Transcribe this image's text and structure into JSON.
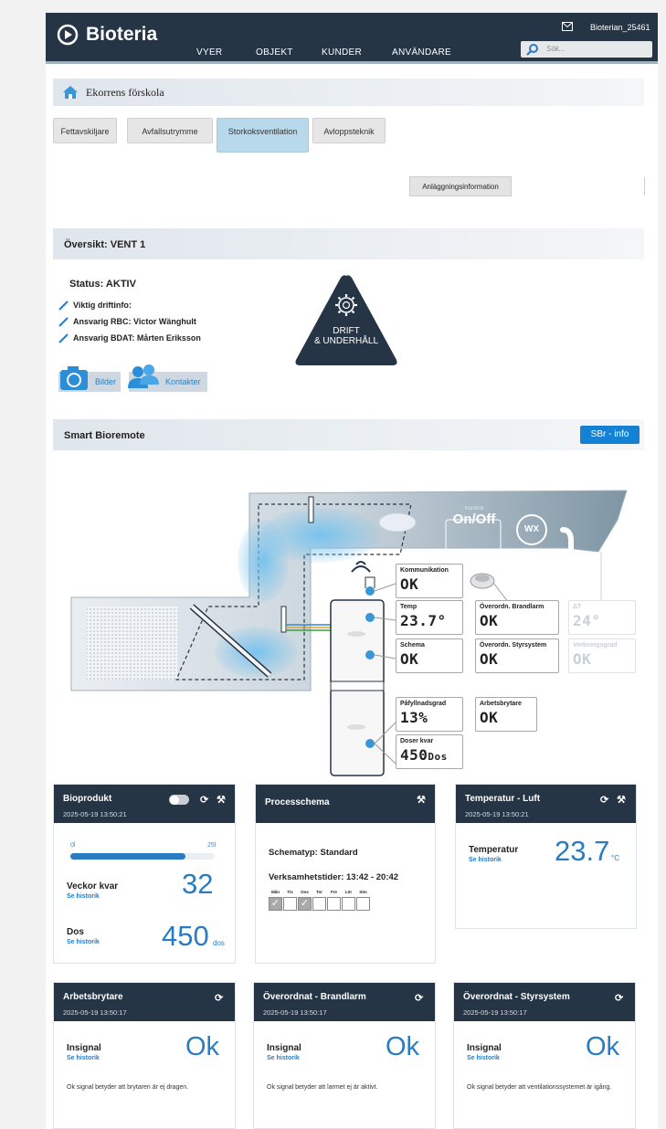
{
  "header": {
    "brand": "Bioteria",
    "nav": [
      "VYER",
      "OBJEKT",
      "KUNDER",
      "ANVÄNDARE"
    ],
    "user": "Bioterian_25461",
    "search_placeholder": "Sök..."
  },
  "site": {
    "name": "Ekorrens förskola"
  },
  "tabs": [
    "Fettavskiljare",
    "Avfallsutrymme",
    "Storkoksventilation",
    "Avloppsteknik"
  ],
  "active_tab": "Storkoksventilation",
  "anlaggning_button": "Anläggningsinformation",
  "overview": {
    "title": "Översikt: VENT 1",
    "status": "Status: AKTIV",
    "lines": [
      "Viktig driftinfo:",
      "Ansvarig RBC: Victor Wänghult",
      "Ansvarig BDAT: Mårten Eriksson"
    ],
    "triangle": [
      "DRIFT",
      "& UNDERHÅLL"
    ],
    "bilder": "Bilder",
    "kontakter": "Kontakter"
  },
  "remote": {
    "title": "Smart Bioremote",
    "info_button": "SBr - info"
  },
  "diagram": {
    "komm": {
      "label": "Kommunikation",
      "value": "OK"
    },
    "temp": {
      "label": "Temp",
      "value": "23.7°"
    },
    "schema": {
      "label": "Schema",
      "value": "OK"
    },
    "brand": {
      "label": "Överordn. Brandlarm",
      "value": "OK"
    },
    "styr": {
      "label": "Överordn. Styrsystem",
      "value": "OK"
    },
    "dt": {
      "label": "ΔT",
      "value": "24°"
    },
    "verk": {
      "label": "Verkningsgrad",
      "value": "OK"
    },
    "pafyll": {
      "label": "Påfyllnadsgrad",
      "value": "13%"
    },
    "arbets": {
      "label": "Arbetsbrytare",
      "value": "OK"
    },
    "doser": {
      "label": "Doser kvar",
      "value": "450",
      "unit": "Dos"
    },
    "onoff_small": "Kontroll",
    "onoff": "On/Off",
    "wx": "WX"
  },
  "cards": {
    "bioprodukt": {
      "title": "Bioprodukt",
      "date": "2025-05-19 13:50:21",
      "bar_min": "0l",
      "bar_max": "25l",
      "fill_fraction": 0.8,
      "veckor_label": "Veckor kvar",
      "veckor_value": "32",
      "dos_label": "Dos",
      "dos_value": "450",
      "dos_unit": "dos",
      "hist": "Se historik"
    },
    "process": {
      "title": "Processchema",
      "schematyp": "Schematyp: Standard",
      "verksamhet": "Verksamhetstider: 13:42 - 20:42",
      "days": [
        "Mån",
        "Tis",
        "Ons",
        "Tor",
        "Fre",
        "Lör",
        "Sön"
      ],
      "checked": [
        true,
        false,
        true,
        false,
        false,
        false,
        false
      ]
    },
    "temp_luft": {
      "title": "Temperatur - Luft",
      "date": "2025-05-19 13:50:21",
      "label": "Temperatur",
      "value": "23.7",
      "unit": "°C",
      "hist": "Se historik"
    },
    "arbets": {
      "title": "Arbetsbrytare",
      "date": "2025-05-19 13:50:17",
      "label": "Insignal",
      "value": "Ok",
      "hist": "Se historik",
      "note": "Ok signal betyder att brytaren är ej dragen."
    },
    "brandlarm": {
      "title": "Överordnat - Brandlarm",
      "date": "2025-05-19 13:50:17",
      "label": "Insignal",
      "value": "Ok",
      "hist": "Se historik",
      "note": "Ok signal betyder att larmet ej är aktivt."
    },
    "styrsystem": {
      "title": "Överordnat - Styrsystem",
      "date": "2025-05-19 13:50:17",
      "label": "Insignal",
      "value": "Ok",
      "hist": "Se historik",
      "note": "Ok signal betyder att ventilationssystemet är igång."
    }
  },
  "colors": {
    "header": "#253545",
    "accent": "#1581d4",
    "value_blue": "#2a7cc2",
    "tab_active": "#b8d8ec"
  }
}
